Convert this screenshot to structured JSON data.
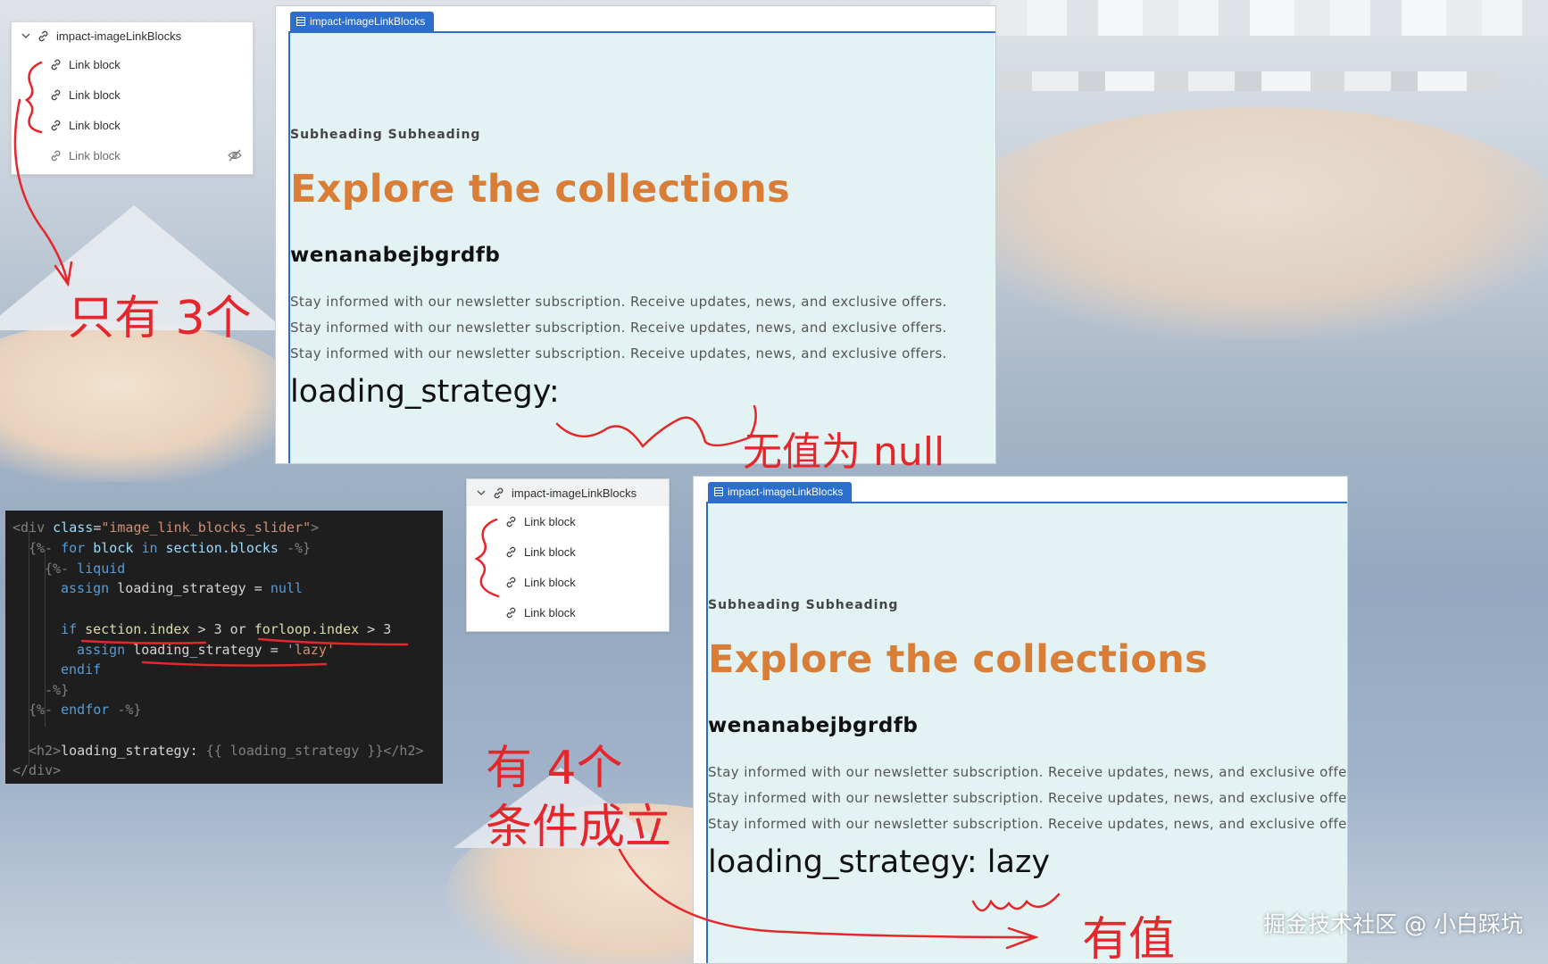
{
  "top_tree": {
    "parent_label": "impact-imageLinkBlocks",
    "items": [
      {
        "label": "Link block",
        "hidden": false
      },
      {
        "label": "Link block",
        "hidden": false
      },
      {
        "label": "Link block",
        "hidden": false
      },
      {
        "label": "Link block",
        "hidden": true
      }
    ]
  },
  "top_preview": {
    "tab_label": "impact-imageLinkBlocks",
    "subheading": "Subheading Subheading",
    "title": "Explore the collections",
    "subtitle": "wenanabejbgrdfb",
    "paragraphs": [
      "Stay informed with our newsletter subscription. Receive updates, news, and exclusive offers.",
      "Stay informed with our newsletter subscription. Receive updates, news, and exclusive offers.",
      "Stay informed with our newsletter subscription. Receive updates, news, and exclusive offers."
    ],
    "strategy_text": "loading_strategy:"
  },
  "bottom_tree": {
    "parent_label": "impact-imageLinkBlocks",
    "items": [
      {
        "label": "Link block"
      },
      {
        "label": "Link block"
      },
      {
        "label": "Link block"
      },
      {
        "label": "Link block"
      }
    ]
  },
  "bottom_preview": {
    "tab_label": "impact-imageLinkBlocks",
    "subheading": "Subheading Subheading",
    "title": "Explore the collections",
    "subtitle": "wenanabejbgrdfb",
    "paragraphs": [
      "Stay informed with our newsletter subscription. Receive updates, news, and exclusive offers.",
      "Stay informed with our newsletter subscription. Receive updates, news, and exclusive offers.",
      "Stay informed with our newsletter subscription. Receive updates, news, and exclusive offers."
    ],
    "strategy_text": "loading_strategy: lazy"
  },
  "code": {
    "l1_open": "<div ",
    "l1_attr": "class",
    "l1_eq": "=",
    "l1_val": "\"image_link_blocks_slider\"",
    "l1_close": ">",
    "l2_open": "{%- ",
    "l2_for": "for",
    "l2_block": " block ",
    "l2_in": "in",
    "l2_rest": " section.blocks ",
    "l2_end": "-%}",
    "l3_open": "{%- ",
    "l3_liquid": "liquid",
    "l4_assign": "assign",
    "l4_rest": " loading_strategy = ",
    "l4_null": "null",
    "l5_if": "if",
    "l5_a": " section.index",
    "l5_b": " > 3 ",
    "l5_or": "or",
    "l5_c": " forloop.index",
    "l5_d": " > 3",
    "l6_assign": "assign",
    "l6_rest": " loading_strategy = ",
    "l6_str": "'lazy'",
    "l7_endif": "endif",
    "l8": "-%}",
    "l9_open": "{%- ",
    "l9_endfor": "endfor",
    "l9_end": " -%}",
    "l10_open": "<h2>",
    "l10_text": "loading_strategy: ",
    "l10_var": "{{ loading_strategy }}",
    "l10_close": "</h2>",
    "l11": "</div>"
  },
  "annotations": {
    "only_three": "只有 3个",
    "null_note": "无值为 null",
    "four_true_line1": "有 4个",
    "four_true_line2": "条件成立",
    "has_value": "有值"
  },
  "watermark": "掘金技术社区 @ 小白踩坑",
  "colors": {
    "accent_blue": "#2c6ecb",
    "title_orange": "#d97d37",
    "annotation_red": "#e5262b",
    "preview_bg": "#e3f3f3"
  }
}
